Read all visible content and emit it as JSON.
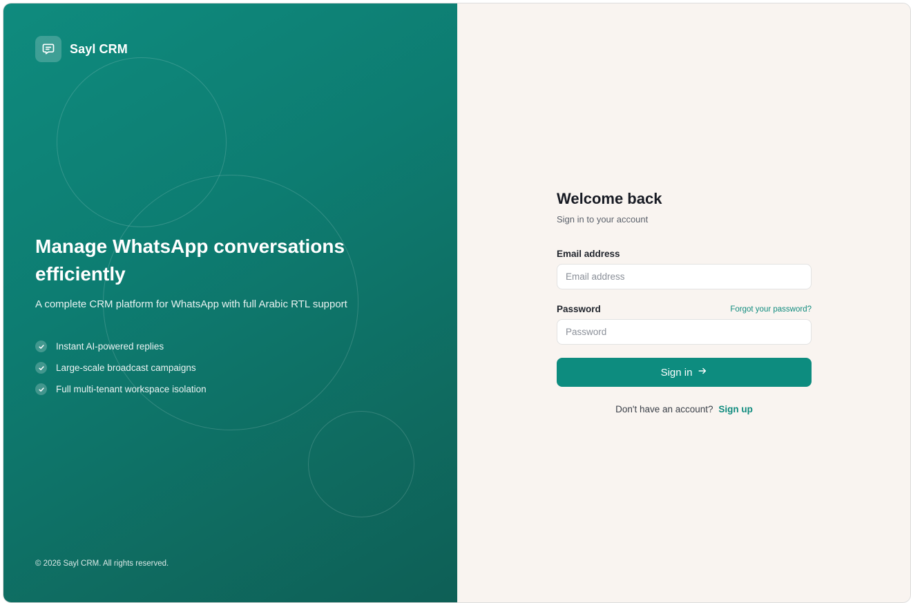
{
  "brand": {
    "name": "Sayl CRM",
    "logo_icon": "chat-bubble-icon"
  },
  "hero": {
    "title": "Manage WhatsApp conversations efficiently",
    "subtitle": "A complete CRM platform for WhatsApp with full Arabic RTL support"
  },
  "features": [
    {
      "icon": "check-circle-icon",
      "label": "Instant AI-powered replies"
    },
    {
      "icon": "check-circle-icon",
      "label": "Large-scale broadcast campaigns"
    },
    {
      "icon": "check-circle-icon",
      "label": "Full multi-tenant workspace isolation"
    }
  ],
  "footer": {
    "copyright": "© 2026 Sayl CRM. All rights reserved."
  },
  "login": {
    "title": "Welcome back",
    "subtitle": "Sign in to your account",
    "email": {
      "label": "Email address",
      "placeholder": "Email address",
      "value": ""
    },
    "password": {
      "label": "Password",
      "placeholder": "Password",
      "value": ""
    },
    "forgot_link": "Forgot your password?",
    "submit_label": "Sign in",
    "submit_icon": "arrow-right-icon",
    "signup_prompt": "Don't have an account?",
    "signup_link": "Sign up"
  },
  "colors": {
    "brand_teal": "#0d8c7f",
    "panel_gradient_start": "#0f8b7e",
    "panel_gradient_end": "#0e5f56",
    "page_background": "#f9f4f0"
  }
}
